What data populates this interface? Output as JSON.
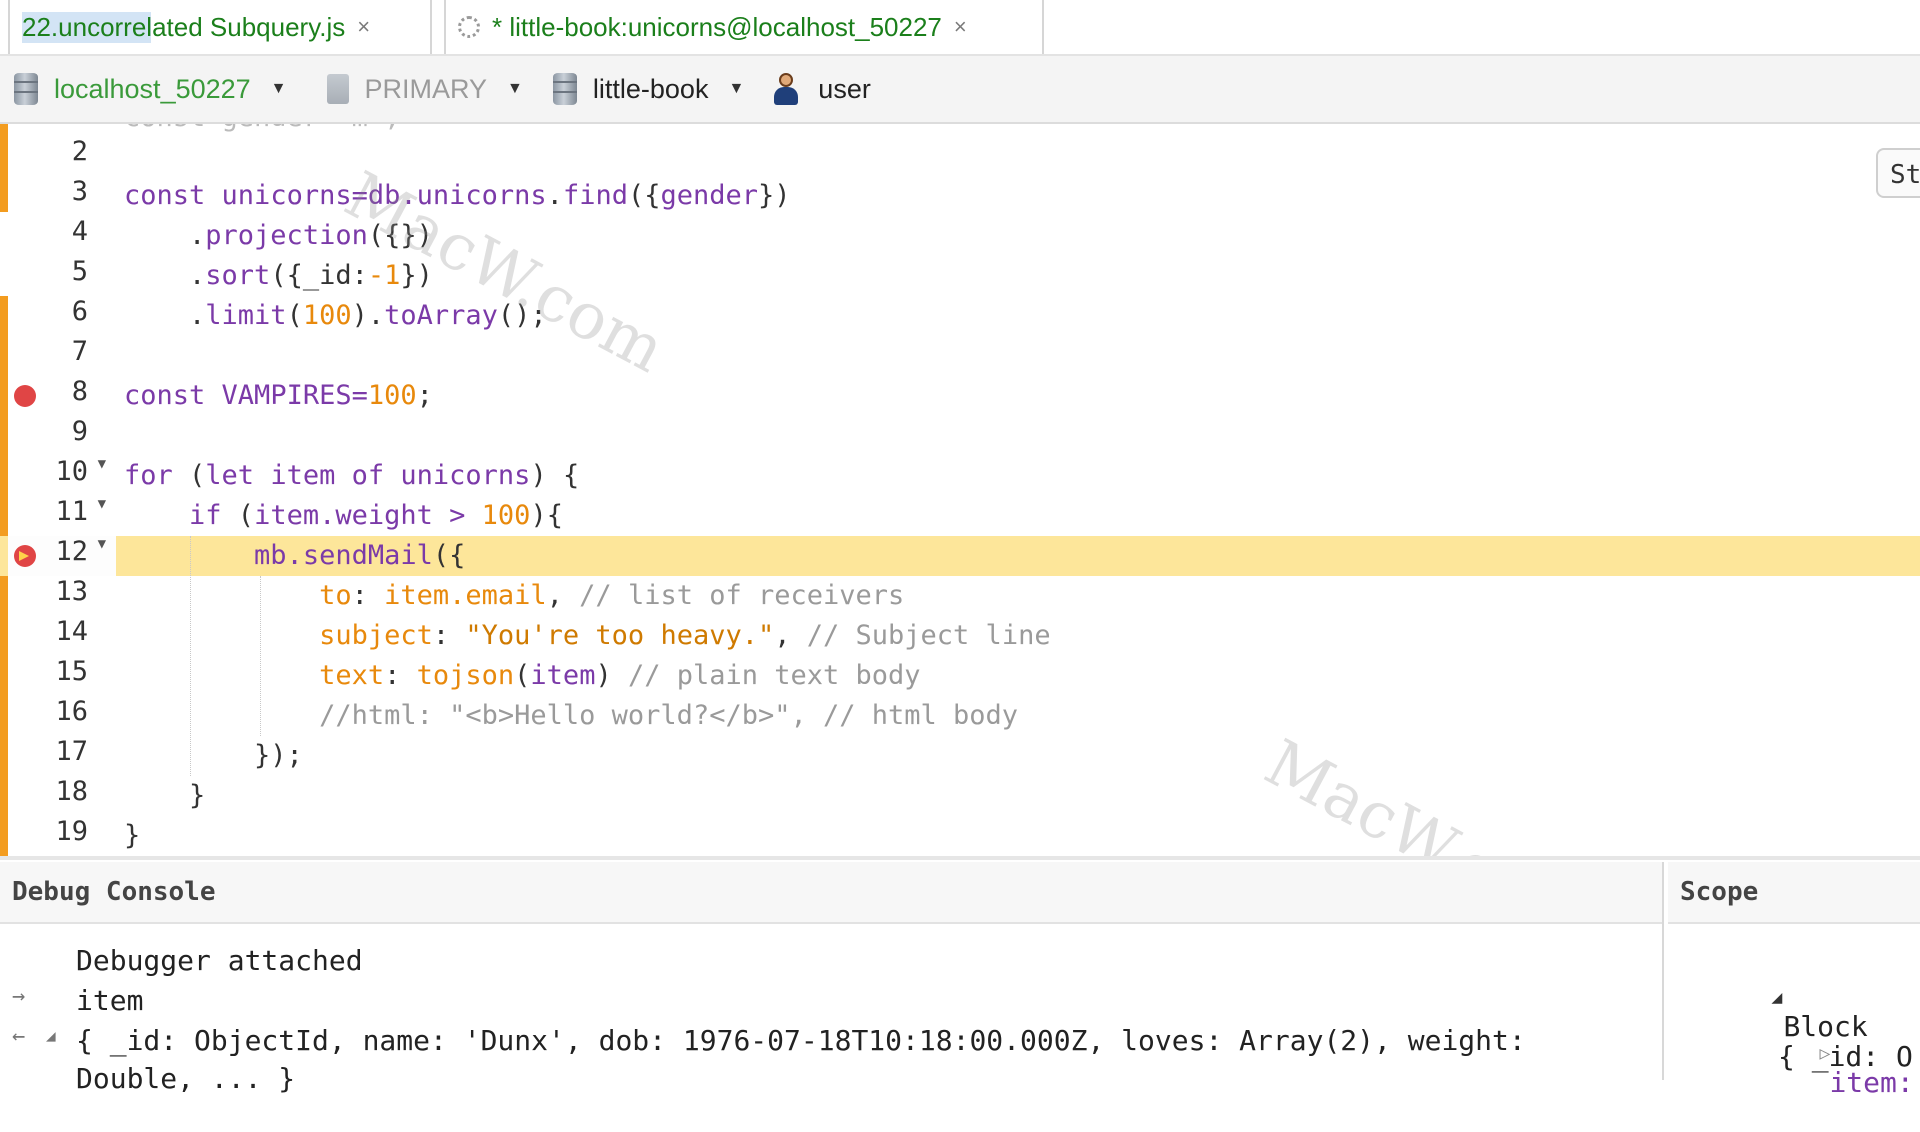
{
  "tabs": [
    {
      "title": "22.uncorrelated Subquery.js",
      "close": "×"
    },
    {
      "title": "* little-book:unicorns@localhost_50227",
      "close": "×"
    }
  ],
  "toolbar": {
    "connection": "localhost_50227",
    "replica": "PRIMARY",
    "database": "little-book",
    "user": "user"
  },
  "editor": {
    "side_button": "St",
    "breakpoint_line": 8,
    "current_line": 12,
    "lines": [
      {
        "n": "2",
        "fold": false
      },
      {
        "n": "3",
        "fold": false
      },
      {
        "n": "4",
        "fold": false
      },
      {
        "n": "5",
        "fold": false
      },
      {
        "n": "6",
        "fold": false
      },
      {
        "n": "7",
        "fold": false
      },
      {
        "n": "8",
        "fold": false
      },
      {
        "n": "9",
        "fold": false
      },
      {
        "n": "10",
        "fold": true
      },
      {
        "n": "11",
        "fold": true
      },
      {
        "n": "12",
        "fold": true
      },
      {
        "n": "13",
        "fold": false
      },
      {
        "n": "14",
        "fold": false
      },
      {
        "n": "15",
        "fold": false
      },
      {
        "n": "16",
        "fold": false
      },
      {
        "n": "17",
        "fold": false
      },
      {
        "n": "18",
        "fold": false
      },
      {
        "n": "19",
        "fold": false
      }
    ],
    "code": {
      "l3_a": "const ",
      "l3_b": "unicorns",
      "l3_c": "=db.",
      "l3_d": "unicorns",
      "l3_e": ".",
      "l3_f": "find",
      "l3_g": "({",
      "l3_h": "gender",
      "l3_i": "})",
      "l4_a": "    .",
      "l4_b": "projection",
      "l4_c": "({})",
      "l5_a": "    .",
      "l5_b": "sort",
      "l5_c": "({_id:",
      "l5_d": "-1",
      "l5_e": "})",
      "l6_a": "    .",
      "l6_b": "limit",
      "l6_c": "(",
      "l6_d": "100",
      "l6_e": ").",
      "l6_f": "toArray",
      "l6_g": "();",
      "l8_a": "const ",
      "l8_b": "VAMPIRES",
      "l8_c": "=",
      "l8_d": "100",
      "l8_e": ";",
      "l10_a": "for ",
      "l10_b": "(",
      "l10_c": "let ",
      "l10_d": "item ",
      "l10_e": "of ",
      "l10_f": "unicorns",
      "l10_g": ") {",
      "l11_a": "    if ",
      "l11_b": "(",
      "l11_c": "item.weight",
      "l11_d": " > ",
      "l11_e": "100",
      "l11_f": "){",
      "l12_a": "        mb.",
      "l12_b": "sendMail",
      "l12_c": "({",
      "l13_a": "            to",
      "l13_b": ": ",
      "l13_c": "item.email",
      "l13_d": ", ",
      "l13_e": "// list of receivers",
      "l14_a": "            subject",
      "l14_b": ": ",
      "l14_c": "\"You're too heavy.\"",
      "l14_d": ", ",
      "l14_e": "// Subject line",
      "l15_a": "            text",
      "l15_b": ": ",
      "l15_c": "tojson",
      "l15_d": "(",
      "l15_e": "item",
      "l15_f": ") ",
      "l15_g": "// plain text body",
      "l16_a": "            //html: \"<b>Hello world?</b>\", // html body",
      "l17_a": "        });",
      "l18_a": "    }",
      "l19_a": "}"
    }
  },
  "debug_console": {
    "title": "Debug Console",
    "lines": [
      "Debugger attached",
      "item",
      "{ _id: ObjectId, name: 'Dunx', dob: 1976-07-18T10:18:00.000Z, loves: Array(2), weight:",
      "Double, ... }"
    ]
  },
  "scope": {
    "title": "Scope",
    "block_label": "Block",
    "item_label": "item:",
    "item_value": "{ _id: O"
  },
  "watermark": "MacW.com",
  "colors": {
    "keyword": "#7b3aa8",
    "number": "#e8890c",
    "comment": "#9a9a9a",
    "current_line": "#fde69a",
    "modified_marker": "#f39c1f",
    "tab_title": "#1b7f1b"
  }
}
